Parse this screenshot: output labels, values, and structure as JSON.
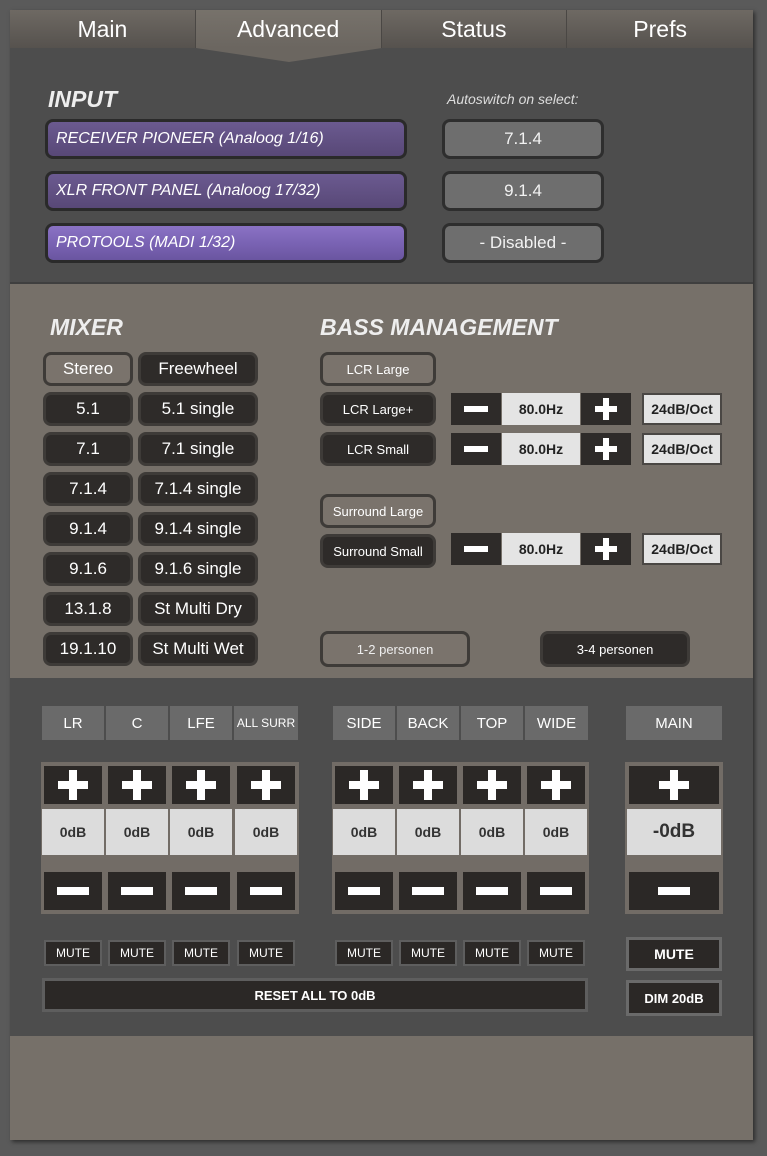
{
  "tabs": [
    {
      "label": "Main",
      "active": false
    },
    {
      "label": "Advanced",
      "active": true
    },
    {
      "label": "Status",
      "active": false
    },
    {
      "label": "Prefs",
      "active": false
    }
  ],
  "input": {
    "heading": "INPUT",
    "autoswitch_label": "Autoswitch on select:",
    "sources": [
      {
        "label": "RECEIVER PIONEER  (Analoog 1/16)",
        "autoswitch": "7.1.4"
      },
      {
        "label": "XLR FRONT PANEL  (Analoog 17/32)",
        "autoswitch": "9.1.4"
      },
      {
        "label": "PROTOOLS  (MADI 1/32)",
        "autoswitch": "- Disabled -",
        "active": true
      }
    ]
  },
  "mixer": {
    "heading": "MIXER",
    "left": [
      "Stereo",
      "5.1",
      "7.1",
      "7.1.4",
      "9.1.4",
      "9.1.6",
      "13.1.8",
      "19.1.10"
    ],
    "right": [
      "Freewheel",
      "5.1 single",
      "7.1 single",
      "7.1.4 single",
      "9.1.4 single",
      "9.1.6 single",
      "St Multi Dry",
      "St Multi Wet"
    ],
    "selected": "Stereo"
  },
  "bass": {
    "heading": "BASS MANAGEMENT",
    "lcr_large": "LCR Large",
    "lcr_large_plus": "LCR Large+",
    "lcr_small": "LCR Small",
    "surround_large": "Surround Large",
    "surround_small": "Surround Small",
    "freq1": "80.0Hz",
    "freq2": "80.0Hz",
    "freq3": "80.0Hz",
    "slope1": "24dB/Oct",
    "slope2": "24dB/Oct",
    "slope3": "24dB/Oct",
    "persons_a": "1-2 personen",
    "persons_b": "3-4 personen"
  },
  "levels": {
    "group1": [
      {
        "name": "LR",
        "db": "0dB",
        "mute": "MUTE"
      },
      {
        "name": "C",
        "db": "0dB",
        "mute": "MUTE"
      },
      {
        "name": "LFE",
        "db": "0dB",
        "mute": "MUTE"
      },
      {
        "name": "ALL SURR",
        "db": "0dB",
        "mute": "MUTE"
      }
    ],
    "group2": [
      {
        "name": "SIDE",
        "db": "0dB",
        "mute": "MUTE"
      },
      {
        "name": "BACK",
        "db": "0dB",
        "mute": "MUTE"
      },
      {
        "name": "TOP",
        "db": "0dB",
        "mute": "MUTE"
      },
      {
        "name": "WIDE",
        "db": "0dB",
        "mute": "MUTE"
      }
    ],
    "main": {
      "name": "MAIN",
      "db": "-0dB",
      "mute": "MUTE",
      "dim": "DIM 20dB"
    },
    "reset": "RESET ALL TO 0dB"
  },
  "colors": {
    "input_active": "#7a63b4",
    "input_inactive": "#584877",
    "dark_button": "#2e2b29",
    "panel_gray": "#4d4d4d",
    "panel_brown": "#767069"
  }
}
